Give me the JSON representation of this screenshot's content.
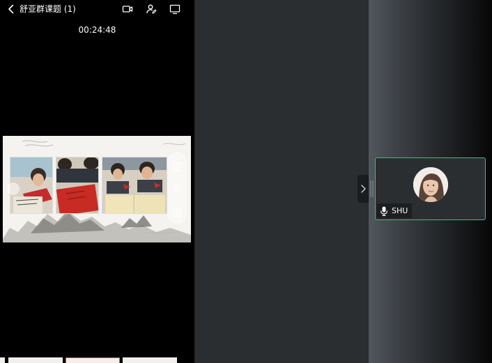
{
  "header": {
    "title": "舒亚群课题 (1)",
    "timer": "00:24:48",
    "icons": [
      "back-chevron-icon",
      "camera-icon",
      "person-edit-icon",
      "screen-share-icon"
    ]
  },
  "slide": {
    "icons": [
      "list-icon",
      "settings-icon",
      "page-icon"
    ]
  },
  "participant": {
    "name": "SHU",
    "mic_icon": "microphone-icon",
    "active_color": "#2fc56b"
  },
  "colors": {
    "left_bg": "#000000",
    "mid_bg": "#2b2e31",
    "tile_border": "#2fc56b"
  }
}
